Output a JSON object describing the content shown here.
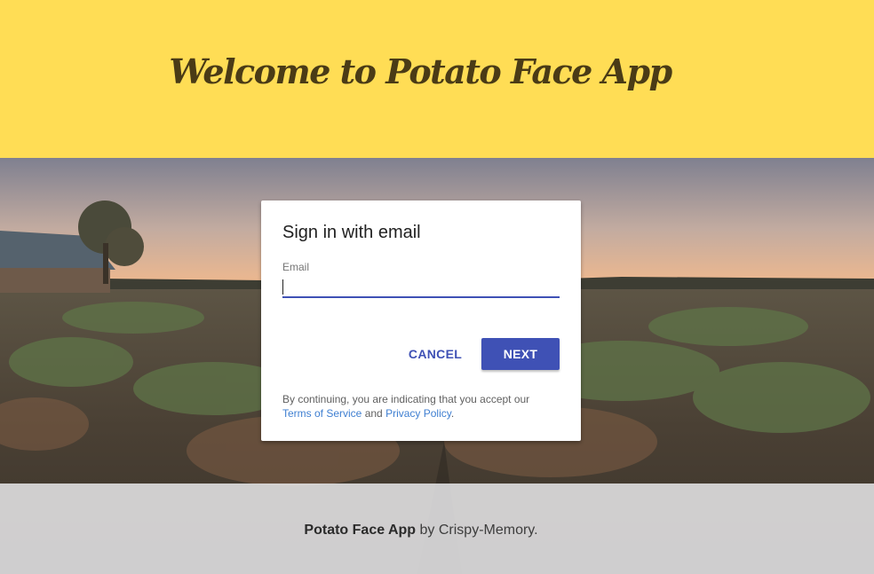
{
  "header": {
    "title": "Welcome to Potato Face App"
  },
  "signin": {
    "title": "Sign in with email",
    "email_label": "Email",
    "email_value": "",
    "cancel_label": "CANCEL",
    "next_label": "NEXT",
    "legal_prefix": "By continuing, you are indicating that you accept our",
    "terms_link": "Terms of Service",
    "legal_and": "and",
    "privacy_link": "Privacy Policy",
    "legal_suffix": "."
  },
  "footer": {
    "brand": "Potato Face App",
    "byline": "by Crispy-Memory."
  },
  "colors": {
    "header_bg": "#ffdd55",
    "title_color": "#4a3b16",
    "accent": "#3f51b5",
    "link": "#3f7fd1"
  }
}
